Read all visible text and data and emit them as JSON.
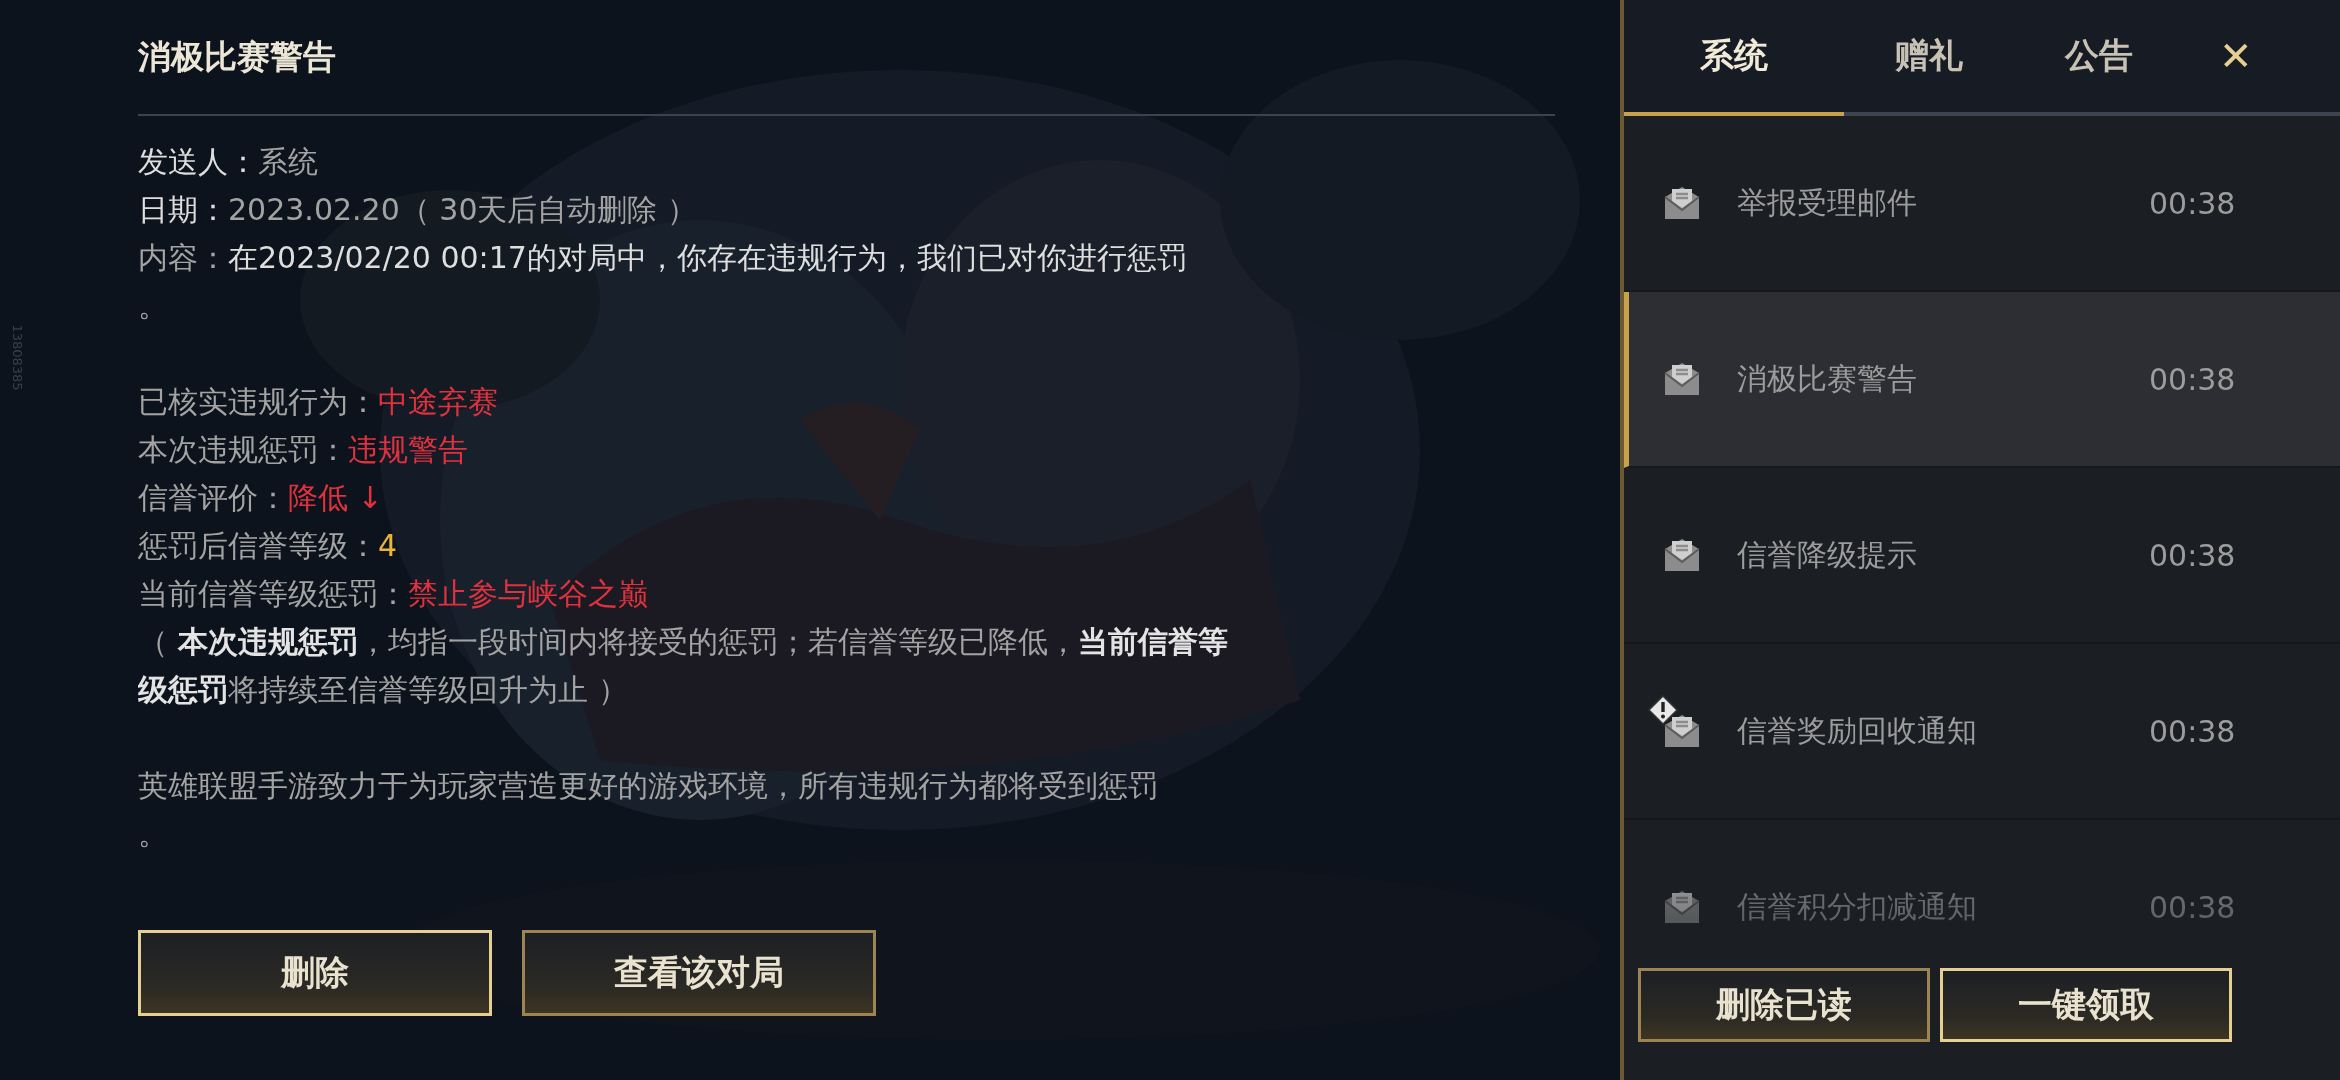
{
  "side_id": "13808385",
  "detail": {
    "title": "消极比赛警告",
    "groups": [
      [
        {
          "segments": [
            {
              "text": "发送人：",
              "color": "#dedede"
            },
            {
              "text": "系统",
              "color": "#a3a3a3"
            }
          ]
        },
        {
          "segments": [
            {
              "text": "日期：",
              "color": "#dedede"
            },
            {
              "text": "2023.02.20（ 30天后自动删除 ）",
              "color": "#a3a3a3"
            }
          ]
        },
        {
          "segments": [
            {
              "text": "内容：",
              "color": "#a3a3a3"
            },
            {
              "text": "在2023/02/20 00:17的对局中，你存在违规行为，我们已对你进行惩罚",
              "color": "#dedede"
            }
          ]
        },
        {
          "segments": [
            {
              "text": "。",
              "color": "#a3a3a3"
            }
          ]
        }
      ],
      [
        {
          "segments": [
            {
              "text": "已核实违规行为：",
              "color": "#a3a3a3"
            },
            {
              "text": "中途弃赛",
              "color": "#e0323e"
            }
          ]
        },
        {
          "segments": [
            {
              "text": "本次违规惩罚：",
              "color": "#a3a3a3"
            },
            {
              "text": "违规警告",
              "color": "#e0323e"
            }
          ]
        },
        {
          "segments": [
            {
              "text": "信誉评价：",
              "color": "#a3a3a3"
            },
            {
              "text": "降低 ↓",
              "color": "#e0323e"
            }
          ]
        },
        {
          "segments": [
            {
              "text": "惩罚后信誉等级：",
              "color": "#a3a3a3"
            },
            {
              "text": "4",
              "color": "#e8b43a"
            }
          ]
        },
        {
          "segments": [
            {
              "text": "当前信誉等级惩罚：",
              "color": "#a3a3a3"
            },
            {
              "text": "禁止参与峡谷之巅",
              "color": "#e0323e"
            }
          ]
        },
        {
          "segments": [
            {
              "text": "（ **本次违规惩罚**，均指一段时间内将接受的惩罚；若信誉等级已降低，**当前信誉等级惩罚**将持续至信誉等级回升为止 ）",
              "color": "#a3a3a3"
            }
          ]
        }
      ],
      [
        {
          "segments": [
            {
              "text": "英雄联盟手游致力于为玩家营造更好的游戏环境，所有违规行为都将受到惩罚",
              "color": "#a3a3a3"
            }
          ]
        },
        {
          "segments": [
            {
              "text": "。",
              "color": "#a3a3a3"
            }
          ]
        }
      ]
    ],
    "buttons": [
      {
        "label": "删除"
      },
      {
        "label": "查看该对局"
      }
    ]
  },
  "panel": {
    "tabs": [
      {
        "label": "系统",
        "selected": true
      },
      {
        "label": "赠礼",
        "selected": false
      },
      {
        "label": "公告",
        "selected": false
      }
    ],
    "close": "✕",
    "mails": [
      {
        "title": "举报受理邮件",
        "time": "00:38",
        "selected": false,
        "alert": false
      },
      {
        "title": "消极比赛警告",
        "time": "00:38",
        "selected": true,
        "alert": false
      },
      {
        "title": "信誉降级提示",
        "time": "00:38",
        "selected": false,
        "alert": false
      },
      {
        "title": "信誉奖励回收通知",
        "time": "00:38",
        "selected": false,
        "alert": true
      },
      {
        "title": "信誉积分扣减通知",
        "time": "00:38",
        "selected": false,
        "alert": false
      }
    ],
    "buttons": [
      {
        "label": "删除已读",
        "primary": false
      },
      {
        "label": "一键领取",
        "primary": true
      }
    ]
  }
}
